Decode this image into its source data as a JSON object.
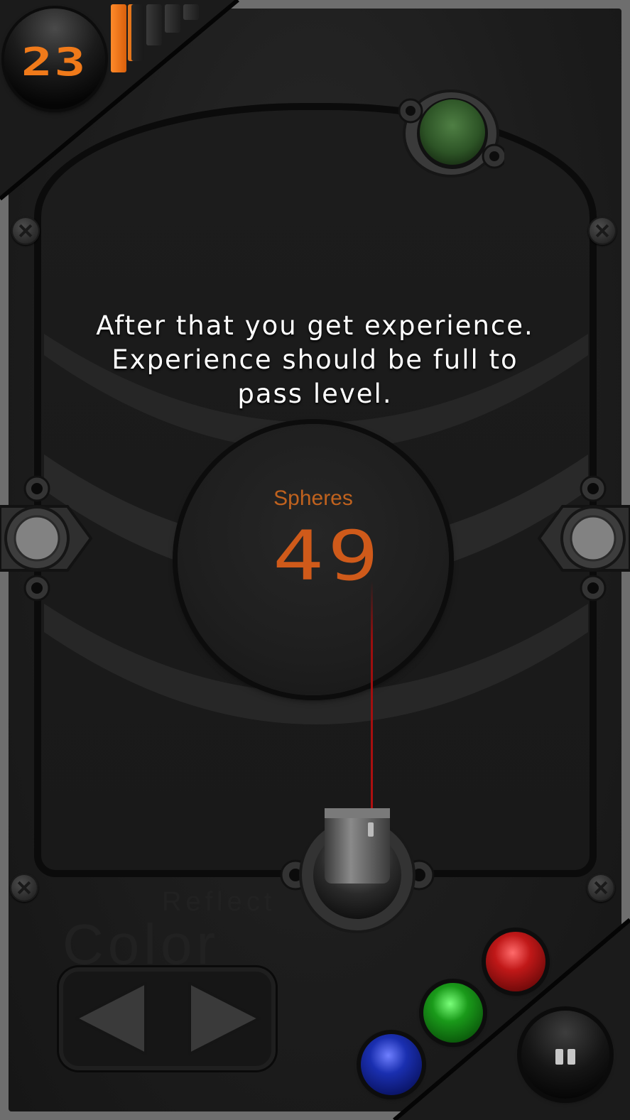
{
  "hud": {
    "level": "23",
    "experience_fraction": 0.2
  },
  "tutorial": {
    "line1": "After that you get experience.",
    "line2": "Experience should be full to",
    "line3": "pass level."
  },
  "counter": {
    "label": "Spheres",
    "value": "49"
  },
  "logo": {
    "line1": "Reflect",
    "line2": "Color"
  },
  "color_balls": [
    {
      "name": "red",
      "color": "#c01818"
    },
    {
      "name": "green",
      "color": "#1a9a1a"
    },
    {
      "name": "blue",
      "color": "#1a2fb0"
    }
  ],
  "colors": {
    "accent": "#f07a1a",
    "counter_text": "#cf5a1a",
    "laser": "#b01010",
    "top_bumper": "#3f6a34"
  }
}
